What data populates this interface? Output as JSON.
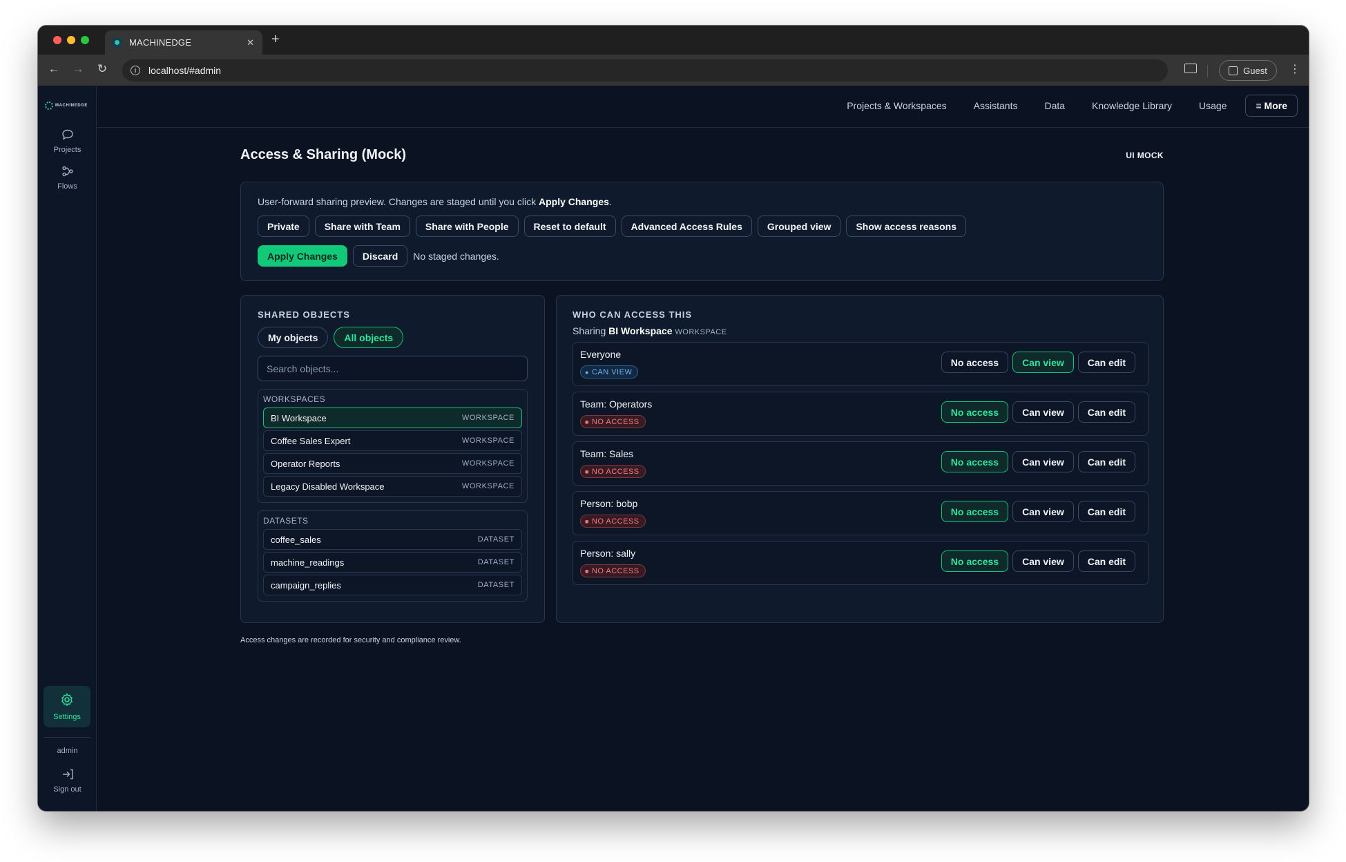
{
  "browser": {
    "tab_title": "MACHINEDGE",
    "tab_close": "✕",
    "new_tab": "+",
    "url": "localhost/#admin",
    "profile": "Guest",
    "back": "←",
    "forward": "→",
    "reload": "↻",
    "menu": "⋮"
  },
  "sidebar": {
    "logo_text": "MACHINEDGE",
    "items": [
      {
        "label": "Projects",
        "icon": "chat-bubble-icon"
      },
      {
        "label": "Flows",
        "icon": "flow-icon"
      }
    ],
    "settings_label": "Settings",
    "user": "admin",
    "signout_label": "Sign out"
  },
  "topnav": {
    "links": [
      "Projects & Workspaces",
      "Assistants",
      "Data",
      "Knowledge Library",
      "Usage"
    ],
    "more_label": "≡ More"
  },
  "page": {
    "title": "Access & Sharing (Mock)",
    "badge": "UI MOCK",
    "footnote": "Access changes are recorded for security and compliance review."
  },
  "preview": {
    "text_prefix": "User-forward sharing preview. Changes are staged until you click ",
    "text_bold": "Apply Changes",
    "text_suffix": ".",
    "buttons": [
      "Private",
      "Share with Team",
      "Share with People",
      "Reset to default",
      "Advanced Access Rules",
      "Grouped view",
      "Show access reasons"
    ],
    "apply_label": "Apply Changes",
    "discard_label": "Discard",
    "status": "No staged changes."
  },
  "shared": {
    "title": "SHARED OBJECTS",
    "filters": [
      "My objects",
      "All objects"
    ],
    "active_filter": "All objects",
    "search_placeholder": "Search objects...",
    "groups": [
      {
        "title": "WORKSPACES",
        "items": [
          {
            "name": "BI Workspace",
            "type": "WORKSPACE",
            "selected": true
          },
          {
            "name": "Coffee Sales Expert",
            "type": "WORKSPACE",
            "selected": false
          },
          {
            "name": "Operator Reports",
            "type": "WORKSPACE",
            "selected": false
          },
          {
            "name": "Legacy Disabled Workspace",
            "type": "WORKSPACE",
            "selected": false
          }
        ]
      },
      {
        "title": "DATASETS",
        "items": [
          {
            "name": "coffee_sales",
            "type": "DATASET",
            "selected": false
          },
          {
            "name": "machine_readings",
            "type": "DATASET",
            "selected": false
          },
          {
            "name": "campaign_replies",
            "type": "DATASET",
            "selected": false
          }
        ]
      }
    ]
  },
  "access": {
    "title": "WHO CAN ACCESS THIS",
    "sharing_prefix": "Sharing ",
    "object_name": "BI Workspace",
    "object_kind": "WORKSPACE",
    "levels": [
      "No access",
      "Can view",
      "Can edit"
    ],
    "rows": [
      {
        "name": "Everyone",
        "badge": "CAN VIEW",
        "badge_kind": "view",
        "level": "Can view"
      },
      {
        "name": "Team: Operators",
        "badge": "NO ACCESS",
        "badge_kind": "none",
        "level": "No access"
      },
      {
        "name": "Team: Sales",
        "badge": "NO ACCESS",
        "badge_kind": "none",
        "level": "No access"
      },
      {
        "name": "Person: bobp",
        "badge": "NO ACCESS",
        "badge_kind": "none",
        "level": "No access"
      },
      {
        "name": "Person: sally",
        "badge": "NO ACCESS",
        "badge_kind": "none",
        "level": "No access"
      }
    ]
  },
  "colors": {
    "accent": "#2ee59d",
    "primary_button": "#12c97a",
    "background": "#0b1322",
    "panel": "#0f1a2c",
    "no_access": "#ef7a82",
    "can_view": "#6fb3f5"
  }
}
